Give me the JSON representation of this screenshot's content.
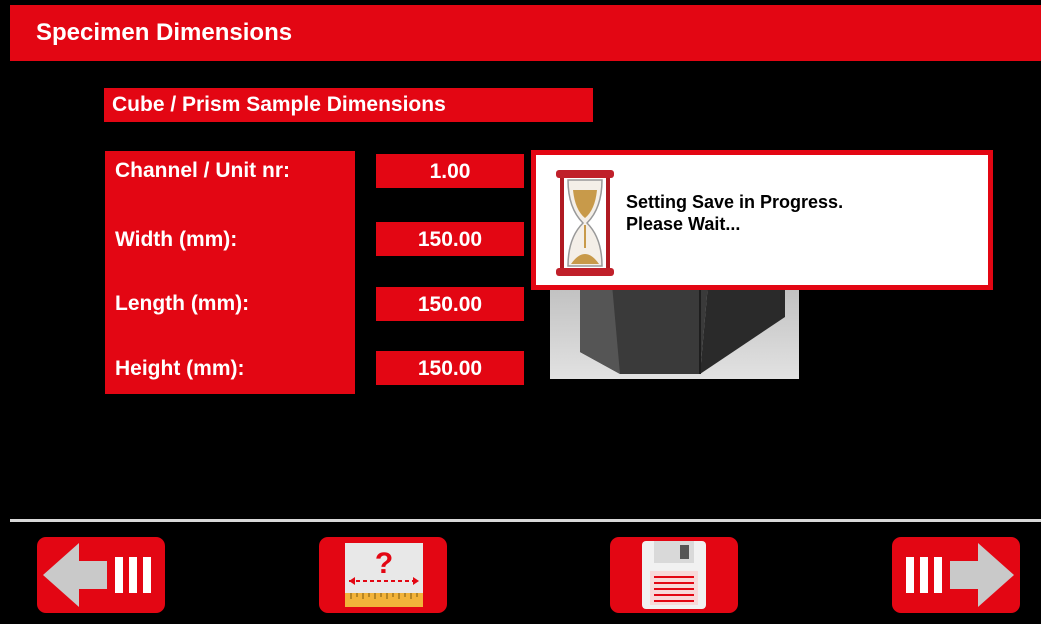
{
  "header": {
    "title": "Specimen Dimensions"
  },
  "section": {
    "title": "Cube / Prism Sample Dimensions"
  },
  "fields": [
    {
      "label": "Channel / Unit nr:",
      "value": "1.00"
    },
    {
      "label": "Width (mm):",
      "value": "150.00"
    },
    {
      "label": "Length (mm):",
      "value": "150.00"
    },
    {
      "label": "Height (mm):",
      "value": "150.00"
    }
  ],
  "dialog": {
    "line1": "Setting Save in Progress.",
    "line2": "Please Wait...",
    "icon": "hourglass-icon"
  },
  "toolbar": {
    "back_icon": "back-arrow-icon",
    "help_icon": "measure-help-icon",
    "help_text": "?",
    "save_icon": "floppy-disk-icon",
    "next_icon": "next-arrow-icon"
  },
  "colors": {
    "accent": "#e30613",
    "background": "#000000",
    "text": "#ffffff"
  }
}
